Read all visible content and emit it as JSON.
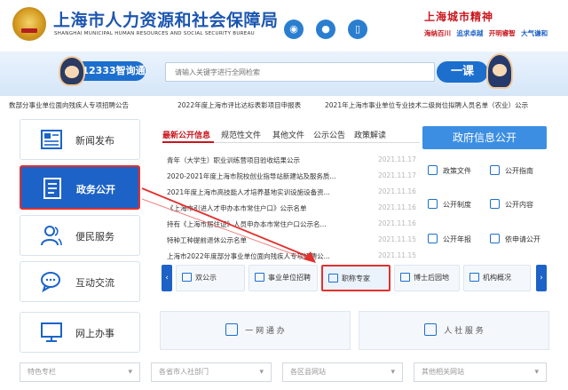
{
  "header": {
    "title": "上海市人力资源和社会保障局",
    "subtitle": "SHANGHAI MUNICIPAL HUMAN RESOURCES AND SOCIAL SECURITY BUREAU",
    "spirit_title": "上海城市精神",
    "spirit_words": [
      {
        "text": "海纳百川",
        "color": "#c8161d"
      },
      {
        "text": "追求卓越",
        "color": "#1d62c6"
      },
      {
        "text": "开明睿智",
        "color": "#c8161d"
      },
      {
        "text": "大气谦和",
        "color": "#1d62c6"
      }
    ],
    "social_icons": [
      "weibo-icon",
      "wechat-icon",
      "mobile-icon"
    ]
  },
  "search": {
    "hotline_label": "12333智询通",
    "placeholder": "请输入关键字进行全网检索",
    "yike_label": "一课"
  },
  "ticker": [
    "数部分事业单位面向残疾人专项招聘公告",
    "2022年度上海市评比达标表彰项目申报表",
    "2021年上海市事业单位专业技术二级岗位拟聘人员名单（农业）公示"
  ],
  "nav": [
    {
      "label": "新闻发布",
      "icon": "newspaper-icon",
      "active": false
    },
    {
      "label": "政务公开",
      "icon": "document-icon",
      "active": true
    },
    {
      "label": "便民服务",
      "icon": "people-icon",
      "active": false
    },
    {
      "label": "互动交流",
      "icon": "chat-icon",
      "active": false
    },
    {
      "label": "网上办事",
      "icon": "monitor-icon",
      "active": false
    }
  ],
  "tabs": [
    "最新公开信息",
    "规范性文件",
    "其他文件",
    "公示公告",
    "政策解读"
  ],
  "news": [
    {
      "title": "青年（大学生）职业训练营项目验收结果公示",
      "date": "2021.11.17"
    },
    {
      "title": "2020-2021年度上海市院校创业指导站新建站及服务质...",
      "date": "2021.11.17"
    },
    {
      "title": "2021年度上海市高技能人才培养基地实训设施设备资...",
      "date": "2021.11.16"
    },
    {
      "title": "《上海市引进人才申办本市常住户口》公示名单",
      "date": "2021.11.16"
    },
    {
      "title": "持有《上海市居住证》人员申办本市常住户口公示名...",
      "date": "2021.11.16"
    },
    {
      "title": "特种工种提前退休公示名单",
      "date": "2021.11.15"
    },
    {
      "title": "上海市2022年度部分事业单位面向残疾人专项招聘公...",
      "date": "2021.11.15"
    }
  ],
  "gov": {
    "button_label": "政府信息公开",
    "links": [
      {
        "label": "政策文件"
      },
      {
        "label": "公开指南"
      },
      {
        "label": "公开制度"
      },
      {
        "label": "公开内容"
      },
      {
        "label": "公开年报"
      },
      {
        "label": "依申请公开"
      }
    ]
  },
  "services": {
    "prev": "‹",
    "next": "›",
    "items": [
      {
        "label": "双公示",
        "highlight": false
      },
      {
        "label": "事业单位招聘",
        "highlight": false
      },
      {
        "label": "职称专家",
        "highlight": true
      },
      {
        "label": "博士后园地",
        "highlight": false
      },
      {
        "label": "机构概况",
        "highlight": false
      }
    ]
  },
  "banners": [
    {
      "label": "一 网 通 办"
    },
    {
      "label": "人 社 服 务"
    }
  ],
  "footer": [
    "特色专栏",
    "各省市人社部门",
    "各区县网站",
    "其他相关网站"
  ],
  "colors": {
    "brand_blue": "#1d62c6",
    "accent_red": "#c8161d",
    "annotation_red": "#e2302d"
  }
}
